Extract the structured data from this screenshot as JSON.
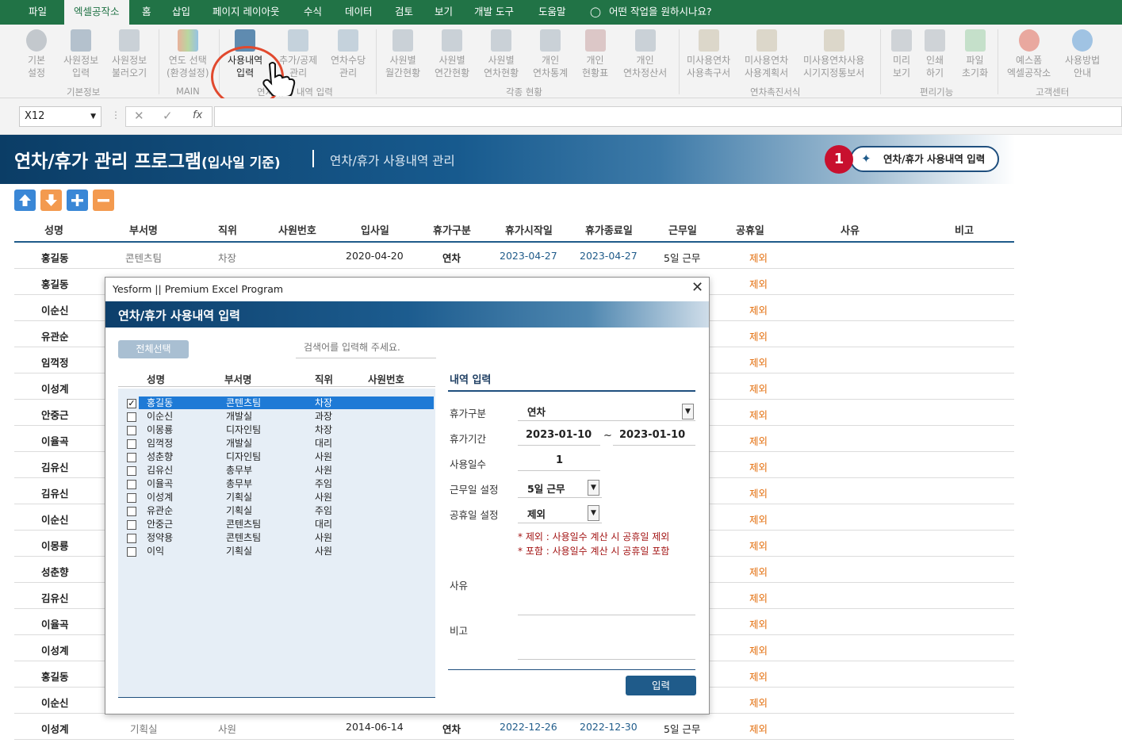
{
  "menu": {
    "tabs": [
      "파일",
      "엑셀공작소",
      "홈",
      "삽입",
      "페이지 레이아웃",
      "수식",
      "데이터",
      "검토",
      "보기",
      "개발 도구",
      "도움말"
    ],
    "tellme": "어떤 작업을 원하시나요?"
  },
  "ribbon": {
    "buttons": [
      {
        "l1": "기본",
        "l2": "설정"
      },
      {
        "l1": "사원정보",
        "l2": "입력"
      },
      {
        "l1": "사원정보",
        "l2": "불러오기"
      },
      {
        "l1": "연도 선택",
        "l2": "(환경설정)"
      },
      {
        "l1": "사용내역",
        "l2": "입력"
      },
      {
        "l1": "추가/공제",
        "l2": "관리"
      },
      {
        "l1": "연차수당",
        "l2": "관리"
      },
      {
        "l1": "사원별",
        "l2": "월간현황"
      },
      {
        "l1": "사원별",
        "l2": "연간현황"
      },
      {
        "l1": "사원별",
        "l2": "연차현황"
      },
      {
        "l1": "개인",
        "l2": "연차통계"
      },
      {
        "l1": "개인",
        "l2": "현황표"
      },
      {
        "l1": "개인",
        "l2": "연차정산서"
      },
      {
        "l1": "미사용연차",
        "l2": "사용촉구서"
      },
      {
        "l1": "미사용연차",
        "l2": "사용계획서"
      },
      {
        "l1": "미사용연차사용",
        "l2": "시기지정통보서"
      },
      {
        "l1": "미리",
        "l2": "보기"
      },
      {
        "l1": "인쇄",
        "l2": "하기"
      },
      {
        "l1": "파일",
        "l2": "초기화"
      },
      {
        "l1": "예스폼",
        "l2": "엑셀공작소"
      },
      {
        "l1": "사용방법",
        "l2": "안내"
      }
    ],
    "groups": [
      "기본정보",
      "MAIN",
      "연차/휴가 내역 입력",
      "각종 현황",
      "연차촉진서식",
      "편리기능",
      "고객센터"
    ]
  },
  "formula": {
    "namebox": "X12"
  },
  "banner": {
    "title": "연차/휴가 관리 프로그램",
    "title_suffix": "(입사일 기준)",
    "subtitle": "연차/휴가 사용내역 관리",
    "callout_num": "1",
    "callout_label": "연차/휴가 사용내역 입력"
  },
  "colors": {
    "excel_green": "#217346",
    "navy": "#1f5b8a",
    "holiday": "#e36c09",
    "date": "#1f5b8a"
  },
  "sheet": {
    "headers": [
      "성명",
      "부서명",
      "직위",
      "사원번호",
      "입사일",
      "휴가구분",
      "휴가시작일",
      "휴가종료일",
      "근무일",
      "공휴일",
      "사유",
      "비고"
    ],
    "rows": [
      {
        "name": "홍길동",
        "dept": "콘텐츠팀",
        "pos": "차장",
        "hire": "2020-04-20",
        "type": "연차",
        "start": "2023-04-27",
        "end": "2023-04-27",
        "work": "5일 근무",
        "hol": "제외"
      },
      {
        "name": "홍길동",
        "hol": "제외"
      },
      {
        "name": "이순신",
        "hol": "제외"
      },
      {
        "name": "유관순",
        "hol": "제외"
      },
      {
        "name": "임꺽정",
        "hol": "제외"
      },
      {
        "name": "이성계",
        "hol": "제외"
      },
      {
        "name": "안중근",
        "hol": "제외"
      },
      {
        "name": "이율곡",
        "hol": "제외"
      },
      {
        "name": "김유신",
        "hol": "제외"
      },
      {
        "name": "김유신",
        "hol": "제외"
      },
      {
        "name": "이순신",
        "hol": "제외"
      },
      {
        "name": "이몽룡",
        "hol": "제외"
      },
      {
        "name": "성춘향",
        "hol": "제외"
      },
      {
        "name": "김유신",
        "hol": "제외"
      },
      {
        "name": "이율곡",
        "hol": "제외"
      },
      {
        "name": "이성계",
        "hol": "제외"
      },
      {
        "name": "홍길동",
        "hol": "제외"
      },
      {
        "name": "이순신",
        "hol": "제외"
      },
      {
        "name": "이성계",
        "dept": "기획실",
        "pos": "사원",
        "hire": "2014-06-14",
        "type": "연차",
        "start": "2022-12-26",
        "end": "2022-12-30",
        "work": "5일 근무",
        "hol": "제외"
      }
    ]
  },
  "dialog": {
    "title": "Yesform  ||  Premium Excel Program",
    "heading": "연차/휴가 사용내역 입력",
    "select_all": "전체선택",
    "search_placeholder": "검색어를 입력해 주세요.",
    "list_headers": [
      "성명",
      "부서명",
      "직위",
      "사원번호"
    ],
    "employees": [
      {
        "name": "홍길동",
        "dept": "콘텐츠팀",
        "pos": "차장",
        "checked": true
      },
      {
        "name": "이순신",
        "dept": "개발실",
        "pos": "과장",
        "checked": false
      },
      {
        "name": "이몽룡",
        "dept": "디자인팀",
        "pos": "차장",
        "checked": false
      },
      {
        "name": "임꺽정",
        "dept": "개발실",
        "pos": "대리",
        "checked": false
      },
      {
        "name": "성춘향",
        "dept": "디자인팀",
        "pos": "사원",
        "checked": false
      },
      {
        "name": "김유신",
        "dept": "총무부",
        "pos": "사원",
        "checked": false
      },
      {
        "name": "이율곡",
        "dept": "총무부",
        "pos": "주임",
        "checked": false
      },
      {
        "name": "이성계",
        "dept": "기획실",
        "pos": "사원",
        "checked": false
      },
      {
        "name": "유관순",
        "dept": "기획실",
        "pos": "주임",
        "checked": false
      },
      {
        "name": "안중근",
        "dept": "콘텐츠팀",
        "pos": "대리",
        "checked": false
      },
      {
        "name": "정약용",
        "dept": "콘텐츠팀",
        "pos": "사원",
        "checked": false
      },
      {
        "name": "이익",
        "dept": "기획실",
        "pos": "사원",
        "checked": false
      }
    ],
    "form": {
      "heading": "내역 입력",
      "type_label": "휴가구분",
      "type_value": "연차",
      "period_label": "휴가기간",
      "start": "2023-01-10",
      "tilde": "~",
      "end": "2023-01-10",
      "days_label": "사용일수",
      "days_value": "1",
      "workday_label": "근무일 설정",
      "workday_value": "5일 근무",
      "holiday_label": "공휴일 설정",
      "holiday_value": "제외",
      "note1": "* 제외 : 사용일수 계산 시 공휴일 제외",
      "note2": "* 포함 : 사용일수 계산 시 공휴일 포함",
      "reason_label": "사유",
      "remark_label": "비고",
      "submit": "입력"
    }
  }
}
